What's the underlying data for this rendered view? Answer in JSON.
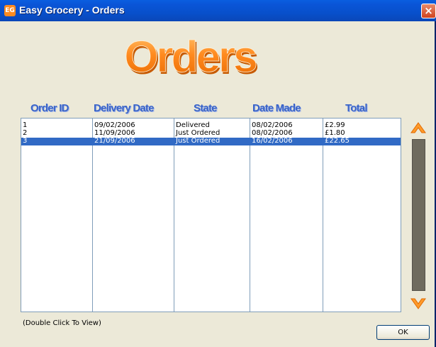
{
  "window": {
    "title": "Easy Grocery - Orders",
    "icon_label": "EG",
    "close_glyph": "×"
  },
  "heading": {
    "text": "Orders"
  },
  "columns": [
    "Order ID",
    "Delivery Date",
    "State",
    "Date Made",
    "Total"
  ],
  "orders": [
    {
      "id": "1",
      "delivery_date": "09/02/2006",
      "state": "Delivered",
      "date_made": "08/02/2006",
      "total": "£2.99"
    },
    {
      "id": "2",
      "delivery_date": "11/09/2006",
      "state": "Just Ordered",
      "date_made": "08/02/2006",
      "total": "£1.80"
    },
    {
      "id": "3",
      "delivery_date": "21/09/2006",
      "state": "Just Ordered",
      "date_made": "16/02/2006",
      "total": "£22.65"
    }
  ],
  "selected_row_index": 2,
  "hint": "(Double Click To View)",
  "ok_label": "OK",
  "icons": {
    "app": "easy-grocery-app-icon",
    "close": "close-icon",
    "scroll_up": "orange-arrow-up-icon",
    "scroll_down": "orange-arrow-down-icon"
  },
  "colors": {
    "titlebar": "#0a55d8",
    "column_header": "#3a64c8",
    "heading_orange": "#ff8a1f",
    "selection": "#316ac5",
    "window_bg": "#ece9d8"
  }
}
